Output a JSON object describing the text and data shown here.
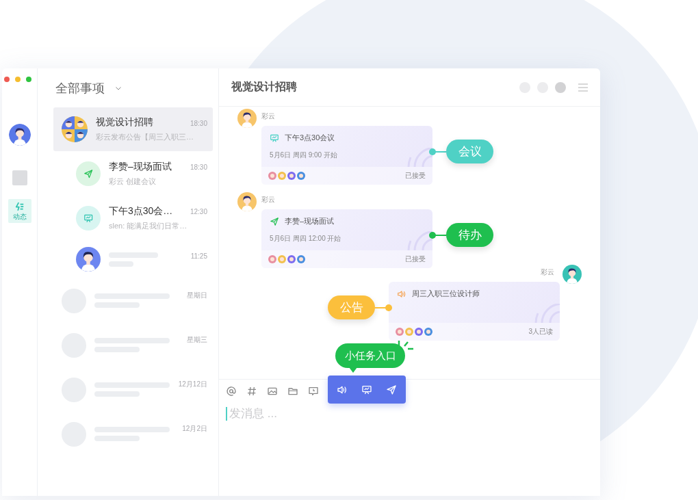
{
  "sidebar": {
    "nav": [
      {
        "kind": "square",
        "selected": false
      },
      {
        "kind": "feed",
        "label": "动态",
        "selected": true
      }
    ]
  },
  "list": {
    "title": "全部事项",
    "conversations": [
      {
        "kind": "group",
        "title": "视觉设计招聘",
        "preview": "彩云发布公告【周三入职三…",
        "time": "18:30",
        "selected": true
      },
      {
        "kind": "todo",
        "title": "李赞–现场面试",
        "preview": "彩云 创建会议",
        "time": "18:30",
        "selected": false
      },
      {
        "kind": "meeting",
        "title": "下午3点30会…",
        "preview": "slen: 能满足我们日常…",
        "time": "12:30",
        "selected": false
      },
      {
        "kind": "person",
        "time": "11:25",
        "selected": false
      },
      {
        "kind": "placeholder",
        "time": "星期日",
        "selected": false
      },
      {
        "kind": "placeholder",
        "time": "星期三",
        "selected": false
      },
      {
        "kind": "placeholder",
        "time": "12月12日",
        "selected": false
      },
      {
        "kind": "placeholder",
        "time": "12月2日",
        "selected": false
      }
    ]
  },
  "chat": {
    "title": "视觉设计招聘",
    "messages": [
      {
        "kind": "incoming",
        "sender": "彩云",
        "card": {
          "kind": "meeting",
          "title": "下午3点30会议",
          "schedule": "5月6日 周四 9:00 开始",
          "status": "已接受"
        },
        "tag": {
          "label": "会议",
          "color": "#4fd1c5"
        }
      },
      {
        "kind": "incoming",
        "sender": "彩云",
        "card": {
          "kind": "todo",
          "title": "李赞–现场面试",
          "schedule": "5月6日 周四 12:00 开始",
          "status": "已接受"
        },
        "tag": {
          "label": "待办",
          "color": "#1fbf4f"
        }
      },
      {
        "kind": "outgoing",
        "sender": "彩云",
        "card": {
          "kind": "notice",
          "title": "周三入职三位设计师",
          "status": "3人已读"
        },
        "tag": {
          "label": "公告",
          "color": "#fbbf3c"
        }
      }
    ],
    "tooltip": "小任务入口"
  },
  "composer": {
    "tools": [
      {
        "kind": "at",
        "highlighted": false
      },
      {
        "kind": "hash",
        "highlighted": false
      },
      {
        "kind": "image",
        "highlighted": false
      },
      {
        "kind": "folder",
        "highlighted": false
      },
      {
        "kind": "clock",
        "highlighted": false
      },
      {
        "kind": "speaker",
        "highlighted": true
      },
      {
        "kind": "board",
        "highlighted": true
      },
      {
        "kind": "plane",
        "highlighted": true
      }
    ],
    "placeholder": "发消息 ..."
  }
}
